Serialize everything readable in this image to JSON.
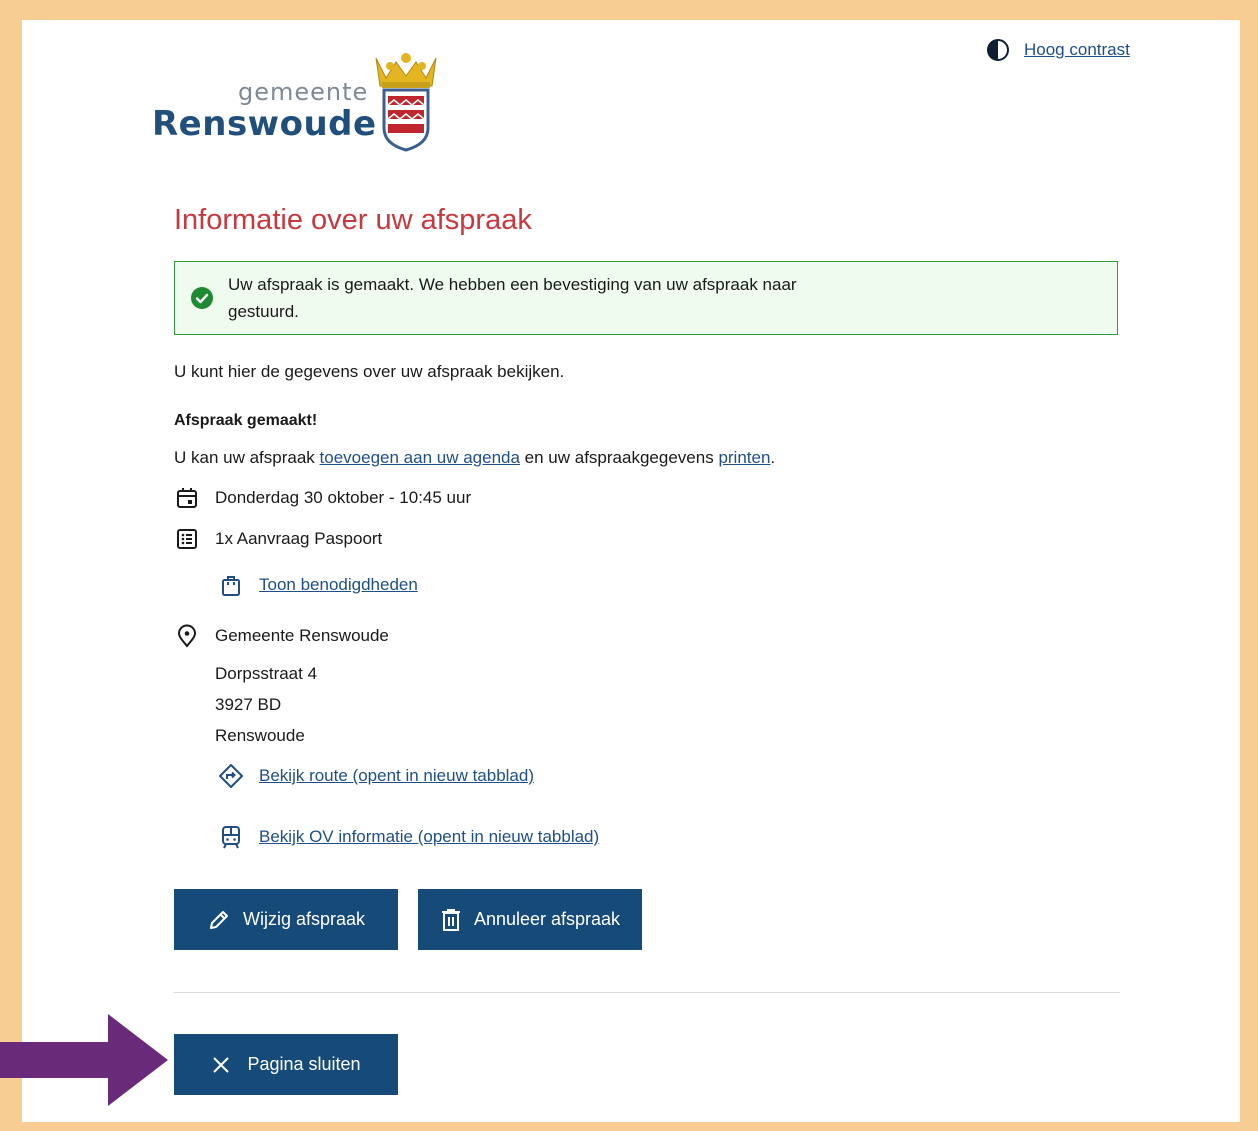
{
  "header": {
    "contrast_label": "Hoog contrast",
    "logo_small": "gemeente",
    "logo_big": "Renswoude"
  },
  "title": "Informatie over uw afspraak",
  "alert": {
    "line1": "Uw afspraak is gemaakt. We hebben een bevestiging van uw afspraak naar",
    "line2": "gestuurd."
  },
  "intro": "U kunt hier de gegevens over uw afspraak bekijken.",
  "section_heading": "Afspraak gemaakt!",
  "calendar_line": {
    "prefix": "U kan uw afspraak",
    "link1": "toevoegen aan uw agenda",
    "middle": "en uw afspraakgegevens",
    "link2": "printen",
    "suffix": "."
  },
  "appointment": {
    "datetime": "Donderdag 30 oktober - 10:45 uur",
    "product": "1x Aanvraag Paspoort",
    "requirements_link": "Toon benodigdheden"
  },
  "location": {
    "name": "Gemeente Renswoude",
    "street": "Dorpsstraat 4",
    "postcode": "3927 BD",
    "city": "Renswoude",
    "route_link": "Bekijk route (opent in nieuw tabblad)",
    "ov_link": "Bekijk OV informatie (opent in nieuw tabblad)"
  },
  "buttons": {
    "edit": "Wijzig afspraak",
    "cancel": "Annuleer afspraak",
    "close": "Pagina sluiten"
  },
  "colors": {
    "frame": "#f7cd93",
    "primary": "#164a78",
    "title": "#c7383f",
    "success": "#2f9e3e",
    "arrow": "#6a2a7a"
  },
  "icons": {
    "contrast": "contrast-icon",
    "check": "check-circle-icon",
    "calendar": "calendar-icon",
    "list": "list-icon",
    "bag": "bag-icon",
    "pin": "map-pin-icon",
    "route": "route-icon",
    "train": "train-icon",
    "pencil": "pencil-icon",
    "trash": "trash-icon",
    "close": "close-icon"
  }
}
